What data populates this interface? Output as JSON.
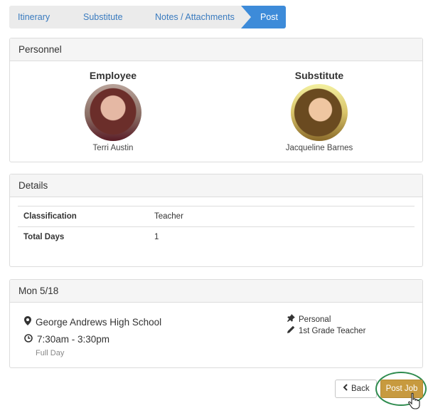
{
  "wizard": {
    "steps": [
      {
        "label": "Itinerary"
      },
      {
        "label": "Substitute"
      },
      {
        "label": "Notes / Attachments"
      },
      {
        "label": "Post"
      }
    ]
  },
  "personnel": {
    "title": "Personnel",
    "employee": {
      "role": "Employee",
      "name": "Terri Austin"
    },
    "substitute": {
      "role": "Substitute",
      "name": "Jacqueline Barnes"
    }
  },
  "details": {
    "title": "Details",
    "rows": [
      {
        "key": "Classification",
        "value": "Teacher"
      },
      {
        "key": "Total Days",
        "value": "1"
      }
    ]
  },
  "day": {
    "title": "Mon 5/18",
    "location": "George Andrews High School",
    "time": "7:30am - 3:30pm",
    "duration": "Full Day",
    "reason": "Personal",
    "position": "1st Grade Teacher"
  },
  "actions": {
    "back_label": "Back",
    "post_label": "Post Job"
  },
  "colors": {
    "active_step": "#3d8bd9",
    "link": "#3a7bbf",
    "post_button": "#c79a3f",
    "highlight_ring": "#2e8b4e"
  },
  "icons": [
    "map-marker-icon",
    "clock-icon",
    "thumbtack-icon",
    "pencil-icon",
    "chevron-left-icon",
    "hand-cursor-icon"
  ]
}
